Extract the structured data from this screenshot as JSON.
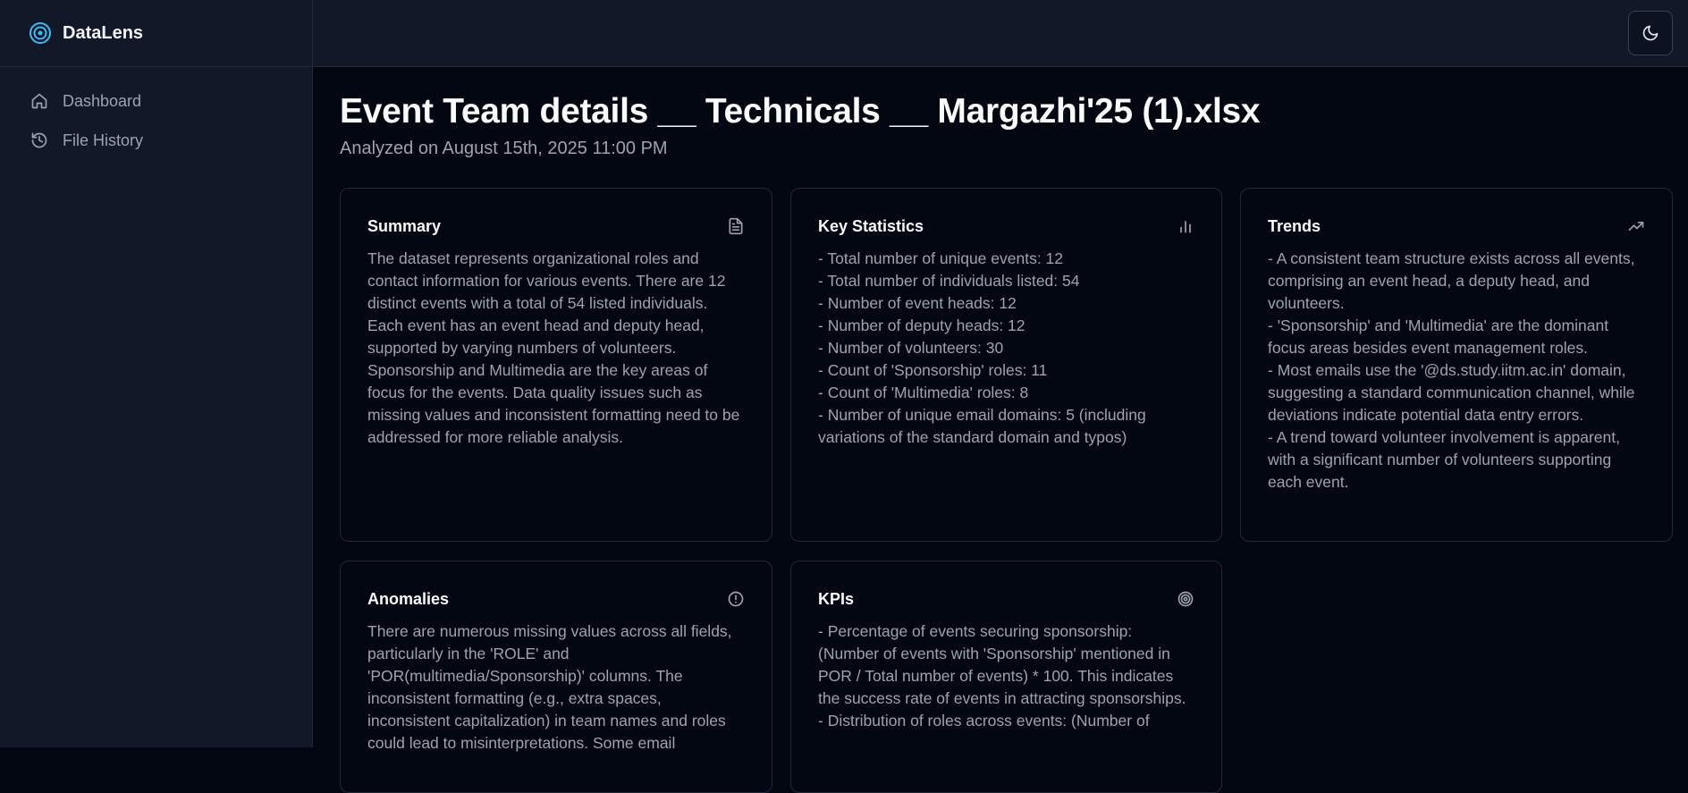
{
  "brand": {
    "name": "DataLens"
  },
  "sidebar": {
    "items": [
      {
        "label": "Dashboard",
        "icon": "home-icon"
      },
      {
        "label": "File History",
        "icon": "history-icon"
      }
    ]
  },
  "topbar": {
    "theme_toggle_icon": "moon-icon"
  },
  "page": {
    "title": "Event Team details __ Technicals __ Margazhi'25 (1).xlsx",
    "subtitle": "Analyzed on August 15th, 2025 11:00 PM"
  },
  "cards": {
    "summary": {
      "title": "Summary",
      "icon": "document-icon",
      "body": "The dataset represents organizational roles and contact information for various events. There are 12 distinct events with a total of 54 listed individuals. Each event has an event head and deputy head, supported by varying numbers of volunteers. Sponsorship and Multimedia are the key areas of focus for the events. Data quality issues such as missing values and inconsistent formatting need to be addressed for more reliable analysis."
    },
    "key_statistics": {
      "title": "Key Statistics",
      "icon": "bar-chart-icon",
      "body": "- Total number of unique events: 12\n- Total number of individuals listed: 54\n- Number of event heads: 12\n- Number of deputy heads: 12\n- Number of volunteers: 30\n- Count of 'Sponsorship' roles: 11\n- Count of 'Multimedia' roles: 8\n- Number of unique email domains: 5 (including variations of the standard domain and typos)"
    },
    "trends": {
      "title": "Trends",
      "icon": "trending-up-icon",
      "body": "- A consistent team structure exists across all events, comprising an event head, a deputy head, and volunteers.\n- 'Sponsorship' and 'Multimedia' are the dominant focus areas besides event management roles.\n- Most emails use the '@ds.study.iitm.ac.in' domain, suggesting a standard communication channel, while deviations indicate potential data entry errors.\n- A trend toward volunteer involvement is apparent, with a significant number of volunteers supporting each event."
    },
    "anomalies": {
      "title": "Anomalies",
      "icon": "alert-circle-icon",
      "body": "There are numerous missing values across all fields, particularly in the 'ROLE' and 'POR(multimedia/Sponsorship)' columns. The inconsistent formatting (e.g., extra spaces, inconsistent capitalization) in team names and roles could lead to misinterpretations. Some email"
    },
    "kpis": {
      "title": "KPIs",
      "icon": "target-icon",
      "body": "- Percentage of events securing sponsorship: (Number of events with 'Sponsorship' mentioned in POR / Total number of events) * 100. This indicates the success rate of events in attracting sponsorships.\n- Distribution of roles across events: (Number of"
    }
  }
}
